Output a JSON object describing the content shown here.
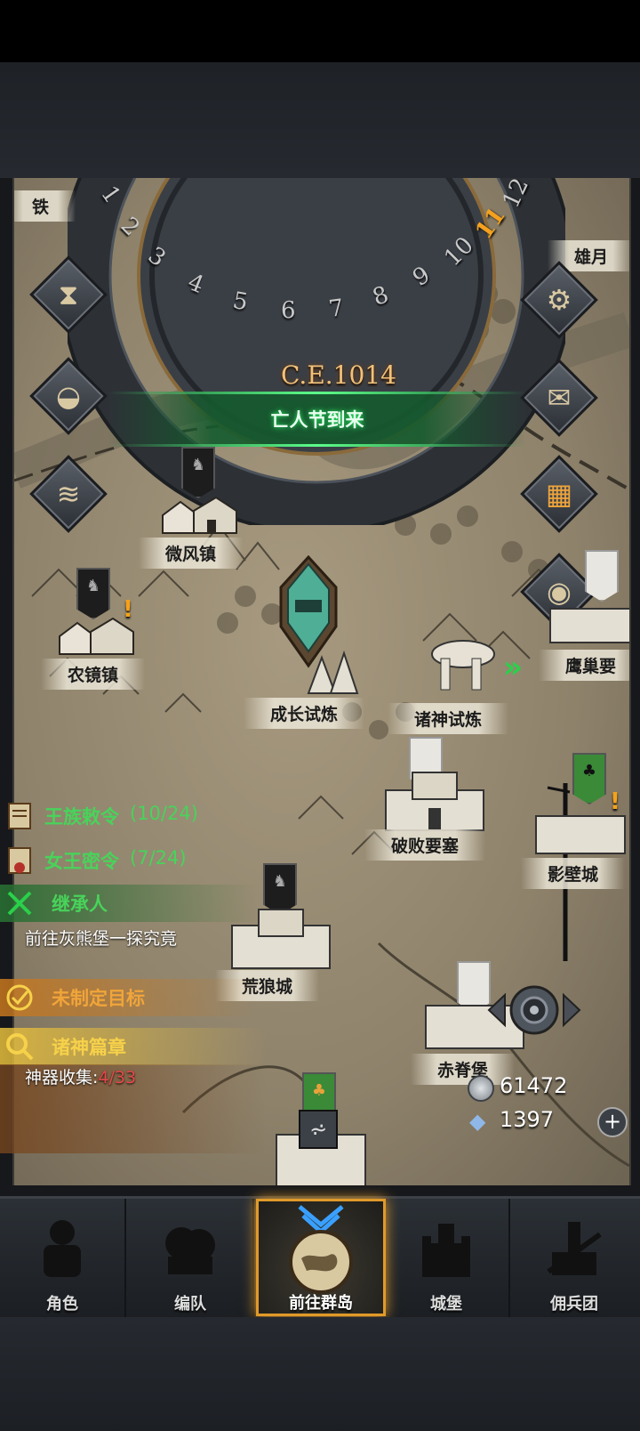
{
  "calendar": {
    "year": "C.E.1014",
    "months": [
      "1",
      "2",
      "3",
      "4",
      "5",
      "6",
      "7",
      "8",
      "9",
      "10",
      "11",
      "12"
    ],
    "current_month": "11"
  },
  "side_buttons": {
    "left": [
      {
        "name": "hourglass-icon"
      },
      {
        "name": "money-bag-icon"
      },
      {
        "name": "scroll-icon"
      }
    ],
    "right": [
      {
        "name": "gear-icon"
      },
      {
        "name": "mail-icon"
      },
      {
        "name": "ledger-icon"
      },
      {
        "name": "coin-stack-icon"
      }
    ]
  },
  "festival_banner": "亡人节到来",
  "towns": {
    "top_left_partial": "铁",
    "top_right_partial": "雄月",
    "weifeng": "微风镇",
    "nongjing": "农镜镇",
    "chengzhang": "成长试炼",
    "zhushen": "诸神试炼",
    "yingchao": "鹰巢要",
    "pobai": "破败要塞",
    "yingbi": "影壁城",
    "huanglang": "荒狼城",
    "chiji": "赤脊堡"
  },
  "quests": {
    "royal_edict": {
      "title": "王族敕令",
      "progress": "(10/24)"
    },
    "queen_order": {
      "title": "女王密令",
      "progress": "(7/24)"
    },
    "heir": {
      "title": "继承人",
      "desc": "前往灰熊堡一探究竟"
    },
    "no_goal": {
      "title": "未制定目标"
    },
    "gods_chapter": {
      "title": "诸神篇章",
      "desc_label": "神器收集:",
      "desc_value": "4/33"
    }
  },
  "currency": {
    "silver": "61472",
    "crystal": "1397"
  },
  "nav": [
    {
      "label": "角色"
    },
    {
      "label": "编队"
    },
    {
      "label": "前往群岛"
    },
    {
      "label": "城堡"
    },
    {
      "label": "佣兵团"
    }
  ],
  "colors": {
    "accent_gold": "#e09a2a",
    "quest_green": "#48d35a",
    "quest_orange": "#f0a53a",
    "quest_yellow": "#f6d14a",
    "progress_red": "#e6484a"
  }
}
